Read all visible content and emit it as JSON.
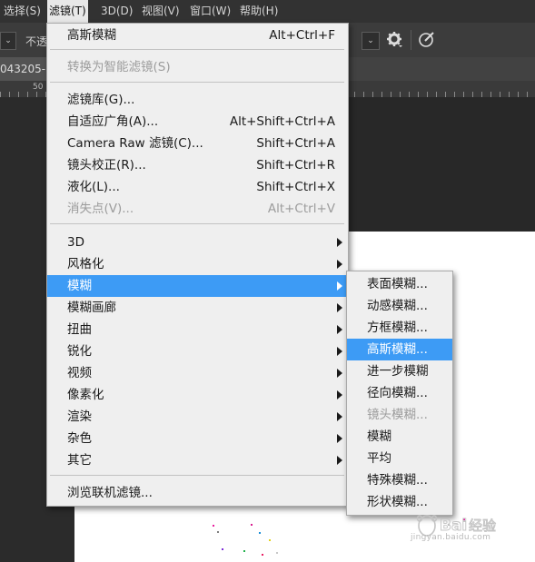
{
  "menubar": {
    "items": [
      "选择(S)",
      "滤镜(T)",
      "3D(D)",
      "视图(V)",
      "窗口(W)",
      "帮助(H)"
    ]
  },
  "options": {
    "opacity_label": "不透"
  },
  "document": {
    "tab_title": "043205-l",
    "ruler_mark": "50"
  },
  "filter_menu": {
    "last_filter": {
      "label": "高斯模糊",
      "shortcut": "Alt+Ctrl+F"
    },
    "convert_smart": {
      "label": "转换为智能滤镜(S)"
    },
    "gallery": {
      "label": "滤镜库(G)..."
    },
    "adaptive_wide": {
      "label": "自适应广角(A)...",
      "shortcut": "Alt+Shift+Ctrl+A"
    },
    "camera_raw": {
      "label": "Camera Raw 滤镜(C)...",
      "shortcut": "Shift+Ctrl+A"
    },
    "lens_correction": {
      "label": "镜头校正(R)...",
      "shortcut": "Shift+Ctrl+R"
    },
    "liquify": {
      "label": "液化(L)...",
      "shortcut": "Shift+Ctrl+X"
    },
    "vanishing_point": {
      "label": "消失点(V)...",
      "shortcut": "Alt+Ctrl+V"
    },
    "groups": [
      "3D",
      "风格化",
      "模糊",
      "模糊画廊",
      "扭曲",
      "锐化",
      "视频",
      "像素化",
      "渲染",
      "杂色",
      "其它"
    ],
    "browse_online": {
      "label": "浏览联机滤镜..."
    }
  },
  "blur_submenu": {
    "items": [
      "表面模糊...",
      "动感模糊...",
      "方框模糊...",
      "高斯模糊...",
      "进一步模糊",
      "径向模糊...",
      "镜头模糊...",
      "模糊",
      "平均",
      "特殊模糊...",
      "形状模糊..."
    ]
  },
  "watermark": {
    "text": "jingyan.baidu.com"
  },
  "colors": {
    "highlight": "#3d9bf5",
    "menu_bg": "#efefef",
    "app_bg": "#2b2b2b"
  }
}
